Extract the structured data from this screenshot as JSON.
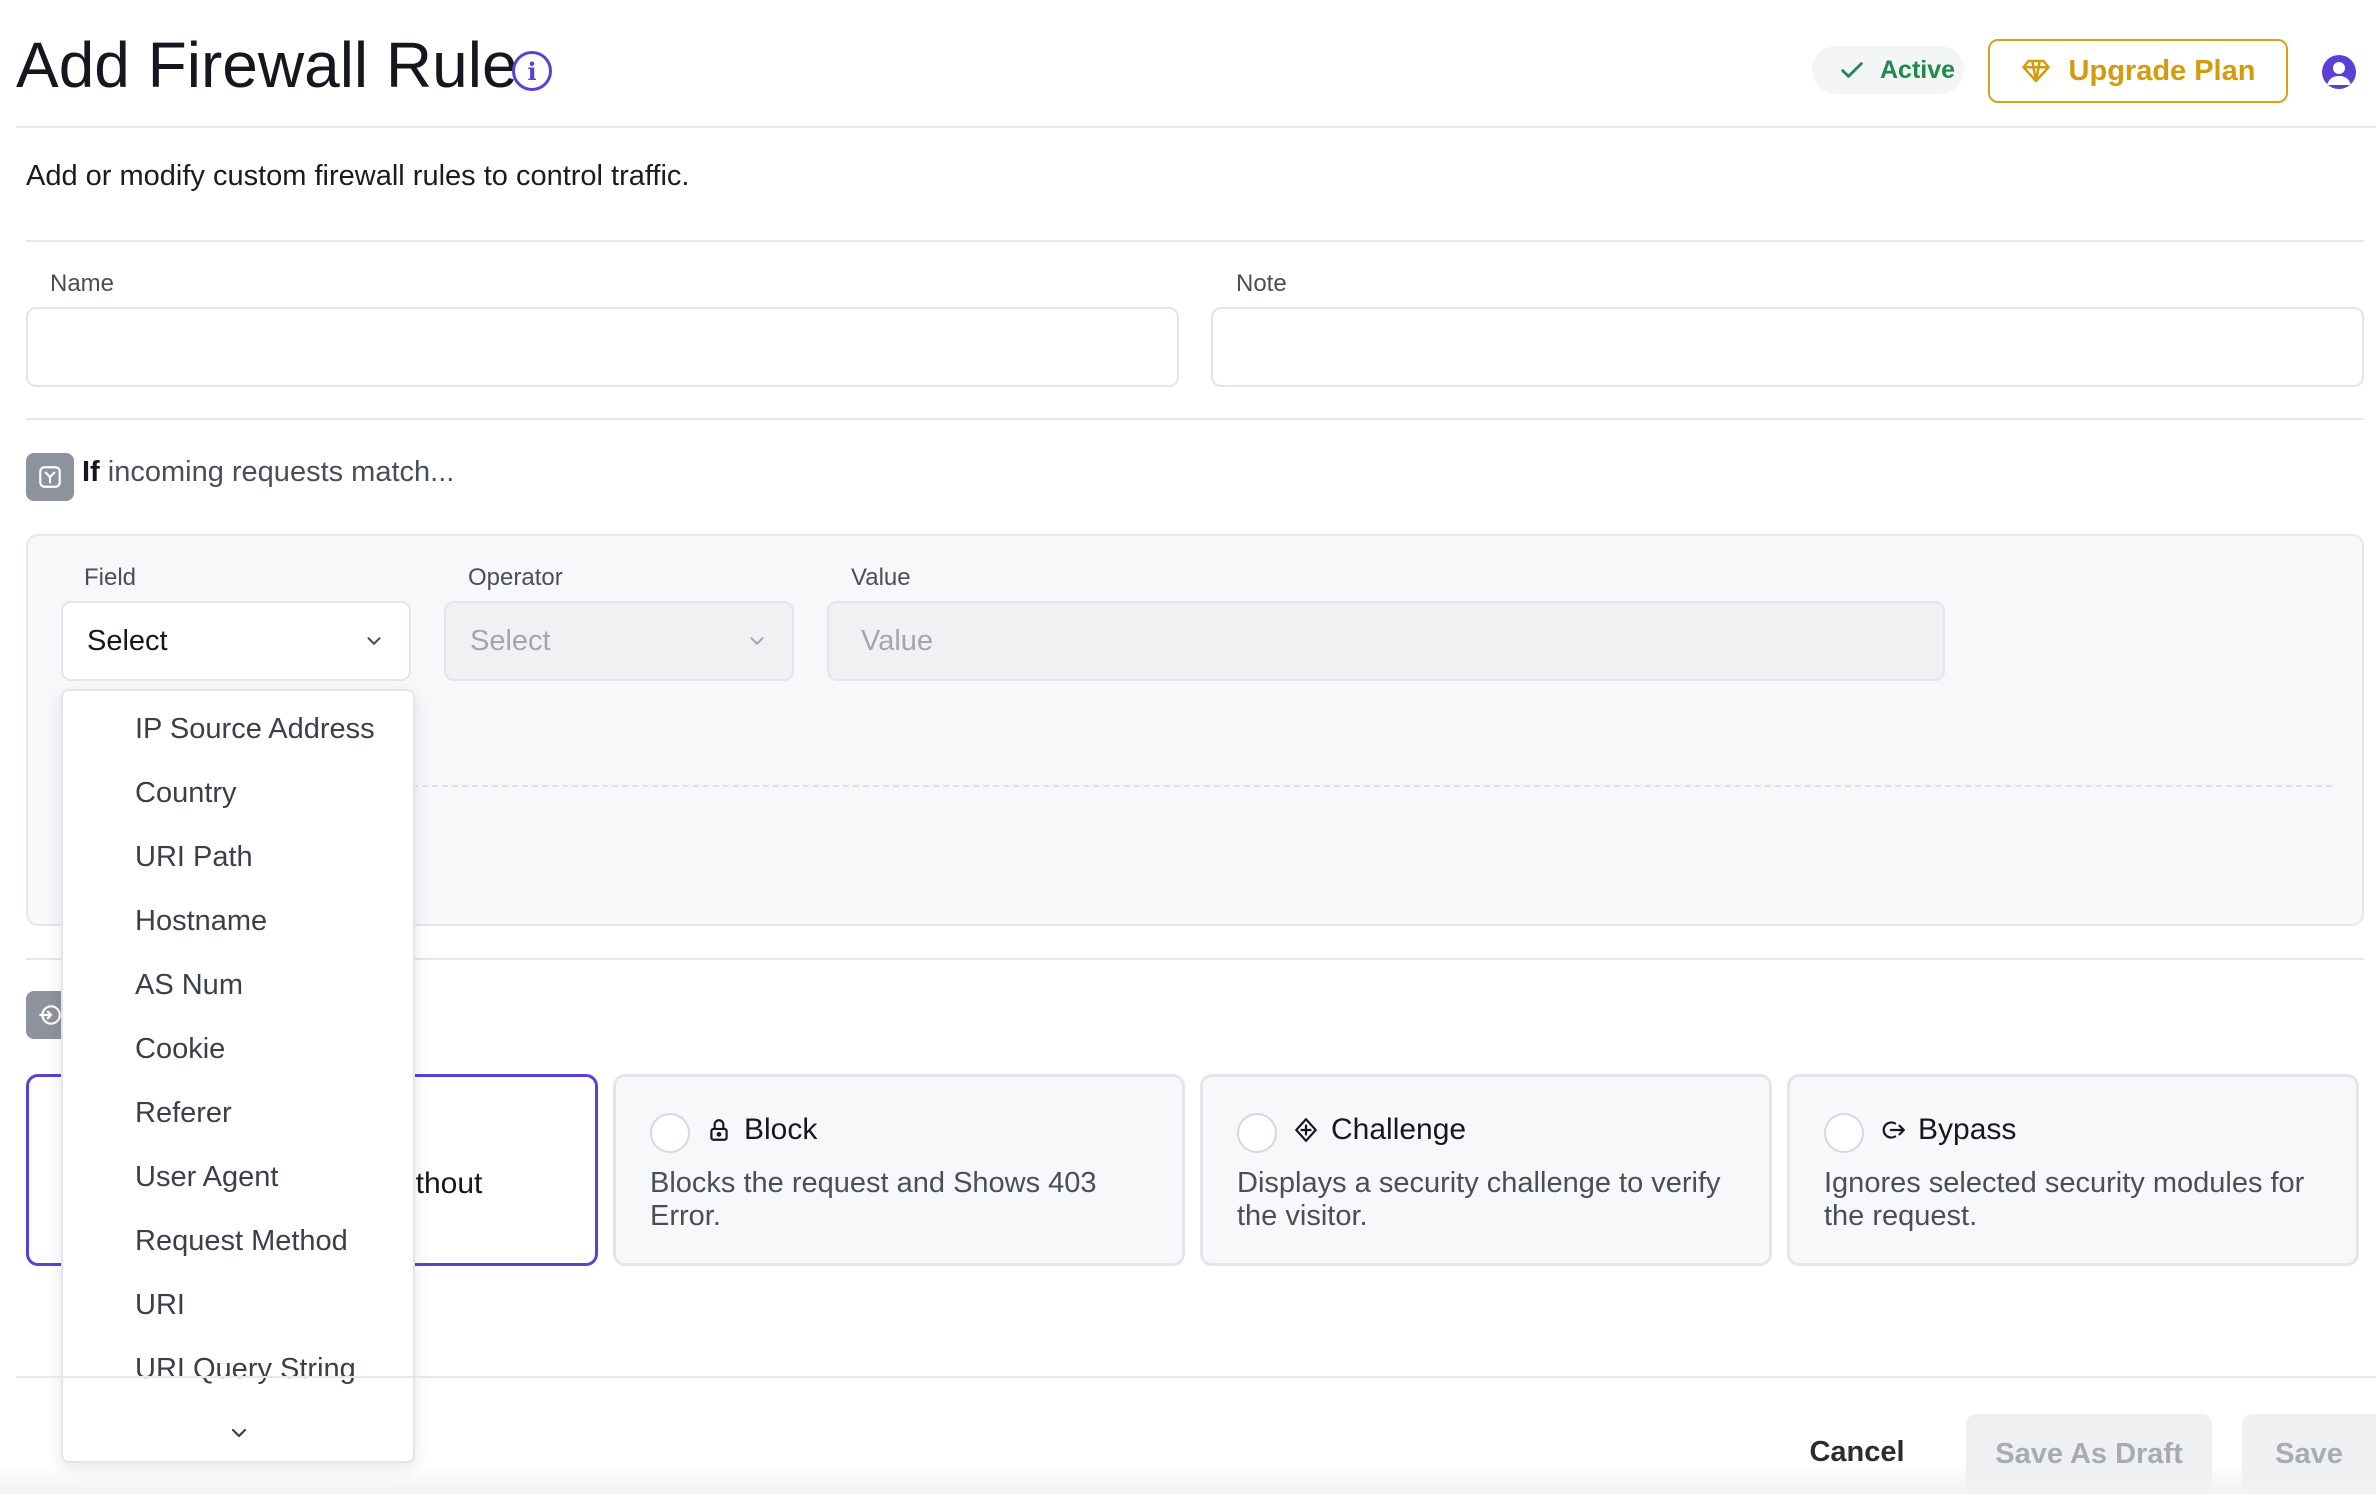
{
  "header": {
    "title": "Add Firewall Rule",
    "status_label": "Active",
    "upgrade_label": "Upgrade Plan"
  },
  "description": "Add or modify custom firewall rules to control traffic.",
  "form": {
    "name_label": "Name",
    "name_value": "",
    "note_label": "Note",
    "note_value": ""
  },
  "condition": {
    "heading_bold": "If",
    "heading_rest": "incoming requests match...",
    "field_label": "Field",
    "field_value": "Select",
    "operator_label": "Operator",
    "operator_value": "Select",
    "value_label": "Value",
    "value_placeholder": "Value"
  },
  "field_dropdown": {
    "options": [
      "IP Source Address",
      "Country",
      "URI Path",
      "Hostname",
      "AS Num",
      "Cookie",
      "Referer",
      "User Agent",
      "Request Method",
      "URI",
      "URI Query String"
    ]
  },
  "actions": [
    {
      "title": "",
      "description": "ithout",
      "selected": true
    },
    {
      "title": "Block",
      "description": "Blocks the request and Shows 403 Error.",
      "icon": "lock-icon"
    },
    {
      "title": "Challenge",
      "description": "Displays a security challenge to verify the visitor.",
      "icon": "challenge-icon"
    },
    {
      "title": "Bypass",
      "description": "Ignores selected security modules for the request.",
      "icon": "bypass-icon"
    }
  ],
  "footer": {
    "cancel_label": "Cancel",
    "draft_label": "Save As Draft",
    "save_label": "Save"
  },
  "colors": {
    "accent": "#5b3fd6",
    "active_green": "#1f8a4c",
    "upgrade_gold": "#d39b0d"
  }
}
